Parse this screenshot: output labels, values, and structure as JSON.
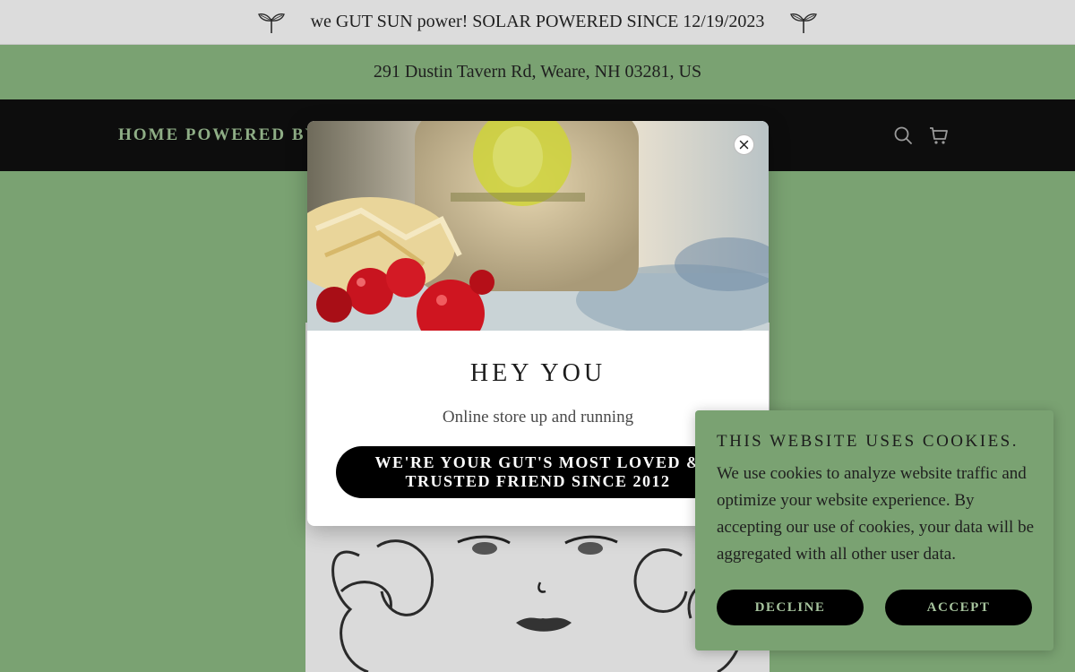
{
  "announcement": {
    "text": "we GUT SUN power! SOLAR POWERED SINCE 12/19/2023"
  },
  "address": {
    "text": "291 Dustin Tavern Rd, Weare, NH 03281, US"
  },
  "nav": {
    "home_label": "HOME POWERED BY",
    "search_icon": "search-icon",
    "cart_icon": "cart-icon"
  },
  "popup": {
    "title": "HEY YOU",
    "subtitle": "Online store up and running",
    "cta_label": "WE'RE YOUR GUT'S MOST LOVED & TRUSTED FRIEND SINCE 2012",
    "close_icon": "close-icon"
  },
  "cookie_banner": {
    "title": "THIS WEBSITE USES COOKIES.",
    "body": "We use cookies to analyze website traffic and optimize your website experience. By accepting our use of cookies, your data will be aggregated with all other user data.",
    "decline_label": "DECLINE",
    "accept_label": "ACCEPT"
  },
  "colors": {
    "page_background": "#7aa272",
    "nav_background": "#0d0d0d",
    "nav_link": "#8fae86",
    "button": "#000000"
  }
}
